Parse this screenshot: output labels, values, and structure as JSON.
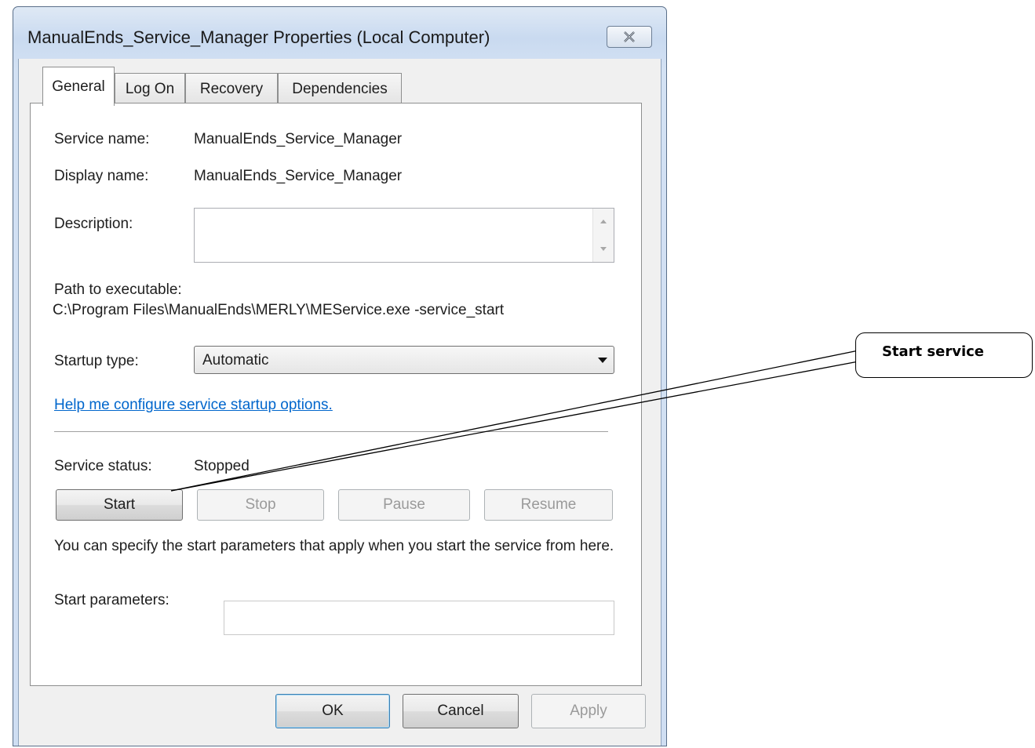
{
  "window": {
    "title": "ManualEnds_Service_Manager Properties (Local Computer)"
  },
  "tabs": [
    {
      "label": "General",
      "active": true
    },
    {
      "label": "Log On",
      "active": false
    },
    {
      "label": "Recovery",
      "active": false
    },
    {
      "label": "Dependencies",
      "active": false
    }
  ],
  "general": {
    "service_name_label": "Service name:",
    "service_name_value": "ManualEnds_Service_Manager",
    "display_name_label": "Display name:",
    "display_name_value": "ManualEnds_Service_Manager",
    "description_label": "Description:",
    "description_value": "",
    "path_label": "Path to executable:",
    "path_value": "C:\\Program Files\\ManualEnds\\MERLY\\MEService.exe -service_start",
    "startup_type_label": "Startup type:",
    "startup_type_value": "Automatic",
    "help_link": "Help me configure service startup options.",
    "service_status_label": "Service status:",
    "service_status_value": "Stopped",
    "buttons": {
      "start": "Start",
      "stop": "Stop",
      "pause": "Pause",
      "resume": "Resume"
    },
    "note": "You can specify the start parameters that apply when you start the service from here.",
    "start_parameters_label": "Start parameters:",
    "start_parameters_value": ""
  },
  "footer": {
    "ok": "OK",
    "cancel": "Cancel",
    "apply": "Apply"
  },
  "callout": {
    "text": "Start service"
  },
  "icons": {
    "close": "close-icon"
  }
}
